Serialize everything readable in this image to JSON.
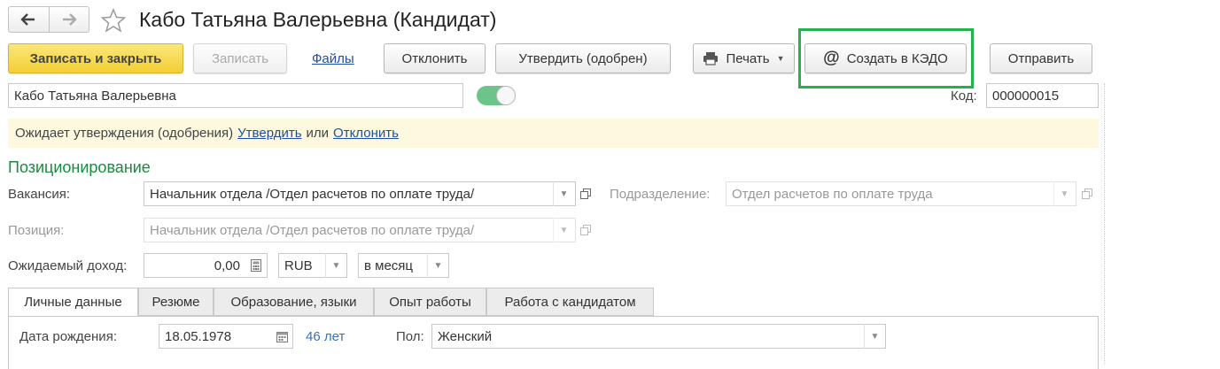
{
  "window": {
    "title": "Кабо Татьяна Валерьевна (Кандидат)"
  },
  "toolbar": {
    "save_close": "Записать и закрыть",
    "save": "Записать",
    "files": "Файлы",
    "reject": "Отклонить",
    "approve": "Утвердить (одобрен)",
    "print": "Печать",
    "create_kedo": "Создать в КЭДО",
    "send": "Отправить"
  },
  "header": {
    "name_value": "Кабо Татьяна Валерьевна",
    "code_label": "Код:",
    "code_value": "000000015"
  },
  "notice": {
    "text": "Ожидает утверждения (одобрения)",
    "approve_link": "Утвердить",
    "or": "или",
    "reject_link": "Отклонить"
  },
  "positioning": {
    "section_title": "Позиционирование",
    "vacancy_label": "Вакансия:",
    "vacancy_value": "Начальник отдела /Отдел расчетов по оплате труда/",
    "department_label": "Подразделение:",
    "department_value": "Отдел расчетов по оплате труда",
    "position_label": "Позиция:",
    "position_value": "Начальник отдела /Отдел расчетов по оплате труда/",
    "income_label": "Ожидаемый доход:",
    "income_value": "0,00",
    "currency_value": "RUB",
    "period_value": "в месяц"
  },
  "tabs": [
    {
      "label": "Личные данные"
    },
    {
      "label": "Резюме"
    },
    {
      "label": "Образование, языки"
    },
    {
      "label": "Опыт работы"
    },
    {
      "label": "Работа с кандидатом"
    }
  ],
  "personal": {
    "birth_label": "Дата рождения:",
    "birth_value": "18.05.1978",
    "age_text": "46 лет",
    "gender_label": "Пол:",
    "gender_value": "Женский"
  },
  "colors": {
    "section_green": "#1a8a3c",
    "highlight_green": "#22b34a",
    "notice_bg": "#fdf9de",
    "toggle_green": "#6cc48a"
  }
}
